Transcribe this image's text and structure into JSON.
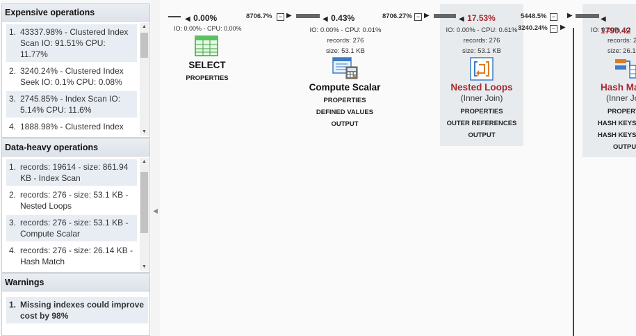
{
  "panels": {
    "expensive": {
      "title": "Expensive operations",
      "items": [
        {
          "num": "1.",
          "text": "43337.98% - Clustered Index Scan IO: 91.51% CPU: 11.77%"
        },
        {
          "num": "2.",
          "text": "3240.24% - Clustered Index Seek IO: 0.1% CPU: 0.08%"
        },
        {
          "num": "3.",
          "text": "2745.85% - Index Scan IO: 5.14% CPU: 11.6%"
        },
        {
          "num": "4.",
          "text": "1888.98% - Clustered Index"
        }
      ]
    },
    "dataheavy": {
      "title": "Data-heavy operations",
      "items": [
        {
          "num": "1.",
          "text": "records: 19614 - size: 861.94 KB - Index Scan"
        },
        {
          "num": "2.",
          "text": "records: 276 - size: 53.1 KB - Nested Loops"
        },
        {
          "num": "3.",
          "text": "records: 276 - size: 53.1 KB - Compute Scalar"
        },
        {
          "num": "4.",
          "text": "records: 276 - size: 26.14 KB - Hash Match"
        }
      ]
    },
    "warnings": {
      "title": "Warnings",
      "items": [
        {
          "num": "1.",
          "text": "Missing indexes could improve cost by 98%"
        }
      ]
    }
  },
  "plan": {
    "select": {
      "pct": "0.00%",
      "io_cpu": "IO: 0.00% - CPU: 0.00%",
      "name": "SELECT",
      "links": [
        "PROPERTIES"
      ]
    },
    "edge1": "8706.7%",
    "compute": {
      "pct": "0.43%",
      "io_cpu": "IO: 0.00% - CPU: 0.01%",
      "records": "records: 276",
      "size": "size: 53.1 KB",
      "name": "Compute Scalar",
      "links": [
        "PROPERTIES",
        "DEFINED VALUES",
        "OUTPUT"
      ]
    },
    "edge2": "8706.27%",
    "nested": {
      "pct": "17.53%",
      "io_cpu": "IO: 0.00% - CPU: 0.61%",
      "records": "records: 276",
      "size": "size: 53.1 KB",
      "name": "Nested Loops",
      "sub": "(Inner Join)",
      "links": [
        "PROPERTIES",
        "OUTER REFERENCES",
        "OUTPUT"
      ]
    },
    "edge3": "5448.5%",
    "edge4": "3240.24%",
    "hash": {
      "pct": "1790.42",
      "io_cpu": "IO: 0.00% - C",
      "records": "records: 2",
      "size": "size: 26.14",
      "name": "Hash Ma",
      "sub": "(Inner Jo",
      "links": [
        "PROPERT",
        "HASH KEYS",
        "HASH KEYS I",
        "OUTPU"
      ]
    }
  },
  "colors": {
    "warning": "#b3171f",
    "hot_operator": "#a8282f",
    "annotation_arrow": "#e8403f"
  }
}
